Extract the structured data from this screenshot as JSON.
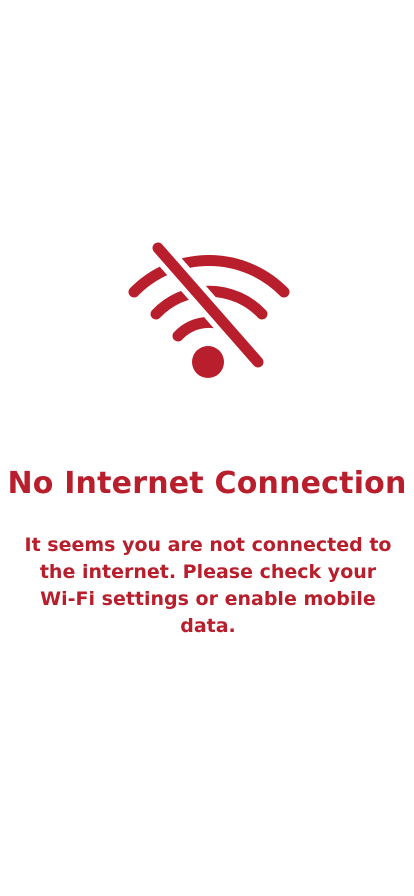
{
  "theme": {
    "accent": "#B81E2B",
    "background": "#FFFFFF"
  },
  "icon": "wifi-off-icon",
  "error": {
    "title": "No Internet Connection",
    "message": "It seems you are not connected to the internet. Please check your Wi-Fi settings or enable mobile data."
  }
}
